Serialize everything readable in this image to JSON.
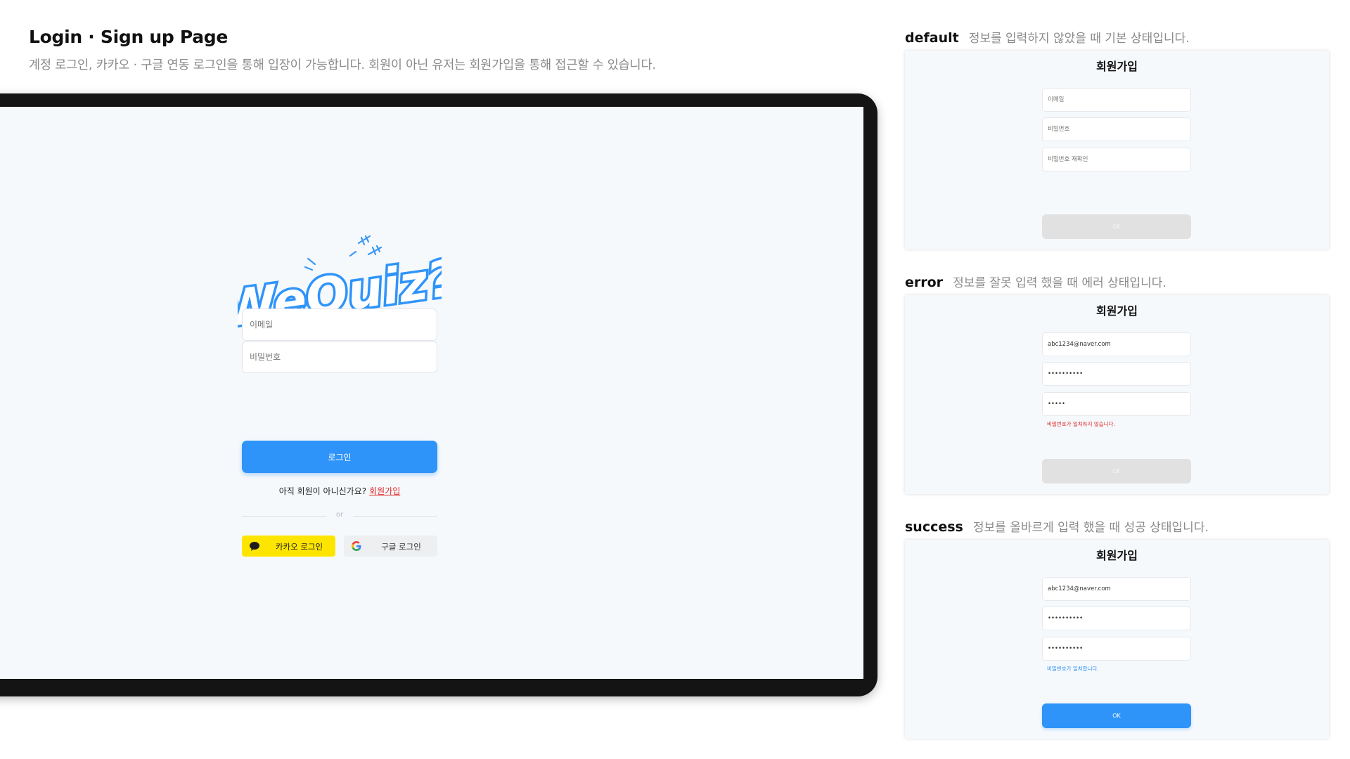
{
  "header": {
    "title": "Login · Sign up Page",
    "subtitle": "계정 로그인, 카카오 · 구글 연동 로그인을 통해 입장이 가능합니다. 회원이 아닌 유저는 회원가입을 통해 접근할 수 있습니다."
  },
  "login": {
    "logo_text": "WeQuiz?",
    "email_placeholder": "이메일",
    "password_placeholder": "비밀번호",
    "login_button": "로그인",
    "join_prompt": "아직 회원이 아니신가요?",
    "join_link": "회원가입",
    "divider_text": "or",
    "kakao_button": "카카오 로그인",
    "google_button": "구글 로그인"
  },
  "states": [
    {
      "label": "default",
      "description": "정보를 입력하지 않았을 때 기본 상태입니다.",
      "panel_title": "회원가입",
      "email": "이메일",
      "password": "비밀번호",
      "password_confirm": "비밀번호 재확인",
      "message": "",
      "button": "OK"
    },
    {
      "label": "error",
      "description": "정보를 잘못 입력 했을 때 에러 상태입니다.",
      "panel_title": "회원가입",
      "email": "abc1234@naver.com",
      "password": "••••••••••",
      "password_confirm": "•••••",
      "message": "비밀번호가 일치하지 않습니다.",
      "button": "OK"
    },
    {
      "label": "success",
      "description": "정보를 올바르게 입력 했을 때 성공 상태입니다.",
      "panel_title": "회원가입",
      "email": "abc1234@naver.com",
      "password": "••••••••••",
      "password_confirm": "••••••••••",
      "message": "비밀번호가 일치합니다.",
      "button": "OK"
    }
  ],
  "colors": {
    "primary": "#2f94f9",
    "kakao": "#fee500",
    "error": "#e02828",
    "success": "#2f94f9"
  }
}
